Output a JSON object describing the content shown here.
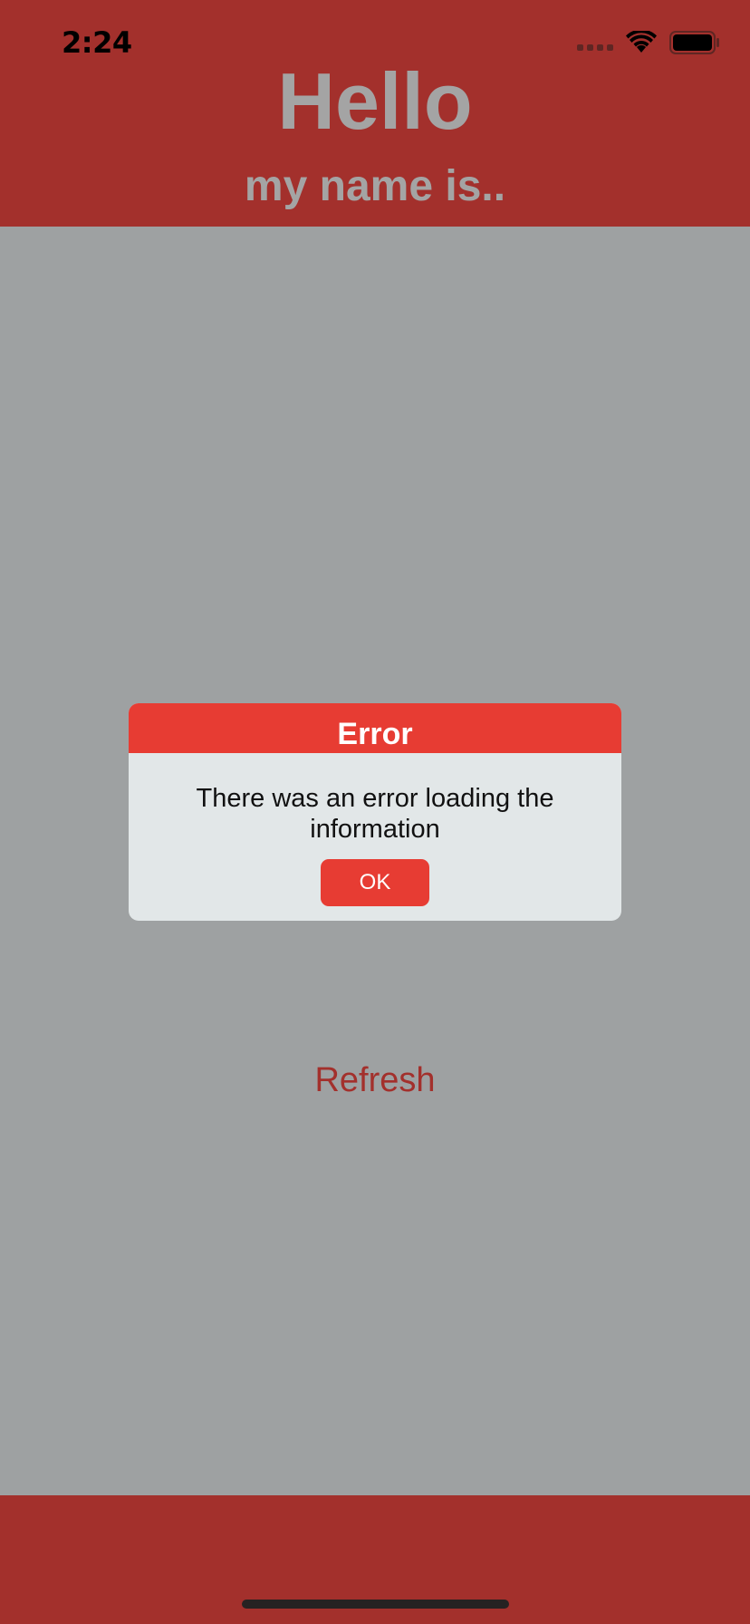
{
  "status_bar": {
    "time": "2:24"
  },
  "header": {
    "title": "Hello",
    "subtitle": "my name is.."
  },
  "dialog": {
    "title": "Error",
    "message": "There was an error loading the information",
    "ok_label": "OK"
  },
  "main": {
    "refresh_label": "Refresh"
  },
  "colors": {
    "brand": "#a3302c",
    "alert": "#e73c33",
    "background": "#9ea1a2",
    "dialog_body": "#e2e7e8",
    "title_text": "#a4a4a4"
  },
  "icons": [
    "signal-icon",
    "wifi-icon",
    "battery-icon"
  ]
}
